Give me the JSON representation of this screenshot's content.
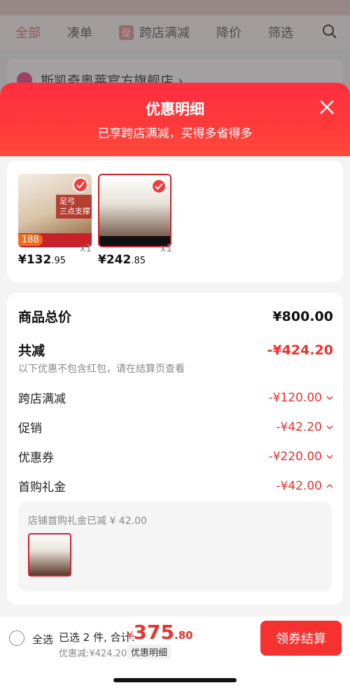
{
  "background": {
    "tabs": [
      "全部",
      "凑单",
      "促",
      "跨店满减",
      "降价",
      "筛选"
    ],
    "store_name": "斯凯奇奥莱官方旗舰店 ›"
  },
  "sheet": {
    "title": "优惠明细",
    "subtitle": "已享跨店满减，买得多省得多",
    "products": [
      {
        "price_int": "¥132",
        "price_dec": ".95",
        "qty": "x1",
        "badge": "188",
        "feature": "足弓\n三点支撑"
      },
      {
        "price_int": "¥242",
        "price_dec": ".85",
        "qty": "x1"
      }
    ],
    "summary": {
      "total_label": "商品总价",
      "total_value": "¥800.00",
      "reduce_label": "共减",
      "reduce_value": "-¥424.20",
      "note": "以下优惠不包含红包，请在结算页查看",
      "items": [
        {
          "label": "跨店满减",
          "value": "-¥120.00"
        },
        {
          "label": "促销",
          "value": "-¥42.20"
        },
        {
          "label": "优惠券",
          "value": "-¥220.00"
        },
        {
          "label": "首购礼金",
          "value": "-¥42.00"
        }
      ],
      "detail_text": "店铺首购礼金已减 ¥ 42.00"
    }
  },
  "bottom": {
    "select_all": "全选",
    "selected": "已选 2 件, 合计:",
    "total_currency": "¥",
    "total_int": "375",
    "total_dec": ".80",
    "discount": "优惠减:¥424.20",
    "detail_pill": "优惠明细",
    "checkout": "领券结算"
  },
  "colors": {
    "accent": "#f5322f",
    "discount_text": "#e8332e"
  }
}
